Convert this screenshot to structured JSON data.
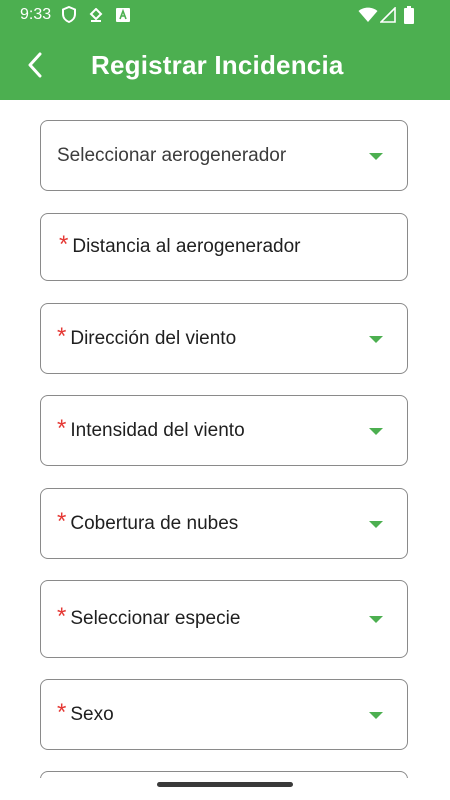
{
  "status_bar": {
    "time": "9:33",
    "icons_left": [
      "shield-icon",
      "download-icon",
      "accessibility-icon"
    ],
    "icons_right": [
      "wifi-icon",
      "signal-icon",
      "battery-icon"
    ]
  },
  "app_bar": {
    "title": "Registrar Incidencia",
    "back_icon": "chevron-left-icon",
    "background_color": "#4caf50"
  },
  "form": {
    "fields": [
      {
        "label": "Seleccionar aerogenerador",
        "required": false,
        "type": "dropdown"
      },
      {
        "label": "Distancia al aerogenerador",
        "required": true,
        "type": "text"
      },
      {
        "label": "Dirección del viento",
        "required": true,
        "type": "dropdown"
      },
      {
        "label": "Intensidad del viento",
        "required": true,
        "type": "dropdown"
      },
      {
        "label": "Cobertura de nubes",
        "required": true,
        "type": "dropdown"
      },
      {
        "label": "Seleccionar especie",
        "required": true,
        "type": "dropdown"
      },
      {
        "label": "Sexo",
        "required": true,
        "type": "dropdown"
      }
    ],
    "required_marker": "*",
    "required_color": "#e53935",
    "dropdown_arrow_color": "#4caf50"
  }
}
